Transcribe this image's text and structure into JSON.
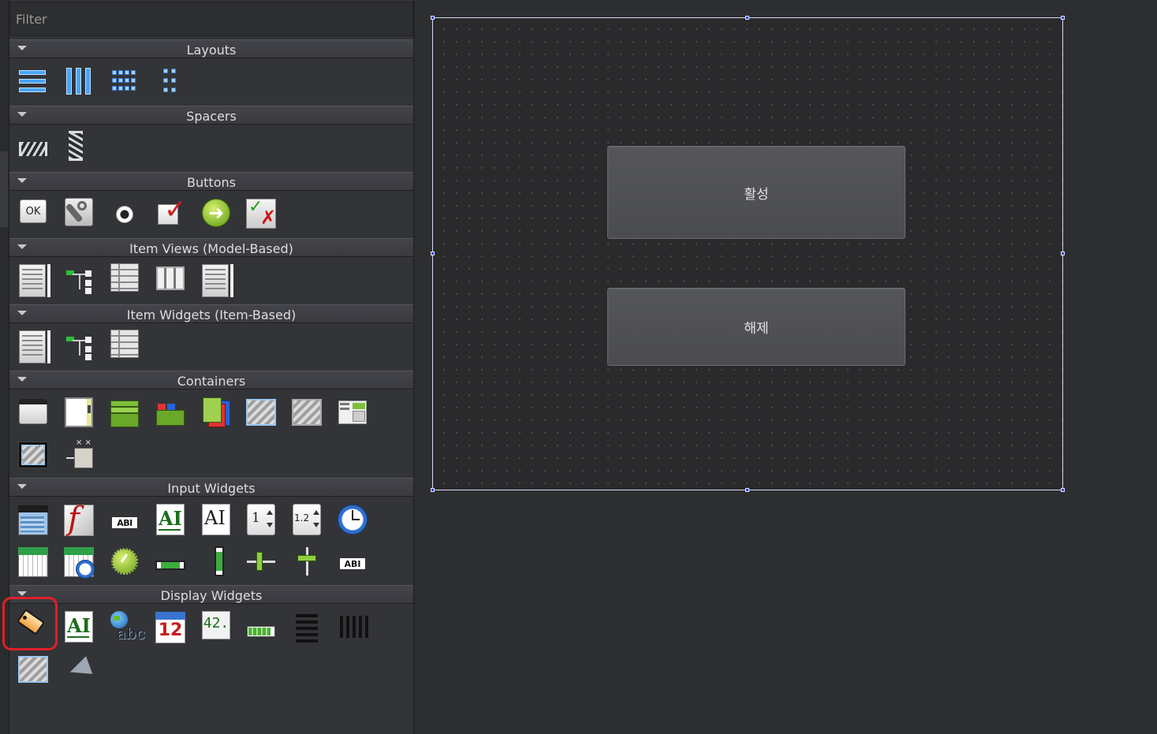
{
  "widget_box": {
    "filter_placeholder": "Filter",
    "categories": [
      {
        "title": "Layouts",
        "items": [
          "vertical-layout-icon",
          "horizontal-layout-icon",
          "grid-layout-icon",
          "form-layout-icon"
        ]
      },
      {
        "title": "Spacers",
        "items": [
          "horizontal-spacer-icon",
          "vertical-spacer-icon"
        ]
      },
      {
        "title": "Buttons",
        "items": [
          "push-button-icon",
          "tool-button-icon",
          "radio-button-icon",
          "check-box-icon",
          "command-link-button-icon",
          "dialog-button-box-icon"
        ]
      },
      {
        "title": "Item Views (Model-Based)",
        "items": [
          "list-view-icon",
          "tree-view-icon",
          "table-view-icon",
          "column-view-icon",
          "undo-view-icon"
        ]
      },
      {
        "title": "Item Widgets (Item-Based)",
        "items": [
          "list-widget-icon",
          "tree-widget-icon",
          "table-widget-icon"
        ]
      },
      {
        "title": "Containers",
        "items": [
          "group-box-icon",
          "scroll-area-icon",
          "tool-box-icon",
          "tab-widget-icon",
          "stacked-widget-icon",
          "frame-icon",
          "widget-icon",
          "mdi-area-icon",
          "dock-widget-icon",
          "qaxwidget-icon"
        ]
      },
      {
        "title": "Input Widgets",
        "items": [
          "combo-box-icon",
          "font-combo-box-icon",
          "line-edit-icon",
          "text-edit-icon",
          "plain-text-edit-icon",
          "spin-box-icon",
          "double-spin-box-icon",
          "time-edit-icon",
          "date-edit-icon",
          "date-time-edit-icon",
          "dial-icon",
          "horizontal-scroll-bar-icon",
          "vertical-scroll-bar-icon",
          "horizontal-slider-icon",
          "vertical-slider-icon",
          "key-sequence-edit-icon"
        ]
      },
      {
        "title": "Display Widgets",
        "items": [
          "label-icon",
          "text-browser-icon",
          "graphics-view-icon",
          "calendar-widget-icon",
          "lcd-number-icon",
          "progress-bar-icon",
          "horizontal-line-icon",
          "vertical-line-icon",
          "opengl-widget-icon",
          "quick-widget-icon"
        ]
      }
    ],
    "icon_text": {
      "ok": "OK",
      "abi": "ABI",
      "ai": "AI",
      "spin": "1",
      "dspin": "1.2",
      "cal": "12",
      "lcd": "42.",
      "abc": "abc"
    },
    "selected_item": "label-icon"
  },
  "form": {
    "buttons": [
      {
        "label": "활성"
      },
      {
        "label": "해제"
      }
    ]
  },
  "colors": {
    "selection_outline": "#e0202a",
    "handle": "#2040d8"
  }
}
